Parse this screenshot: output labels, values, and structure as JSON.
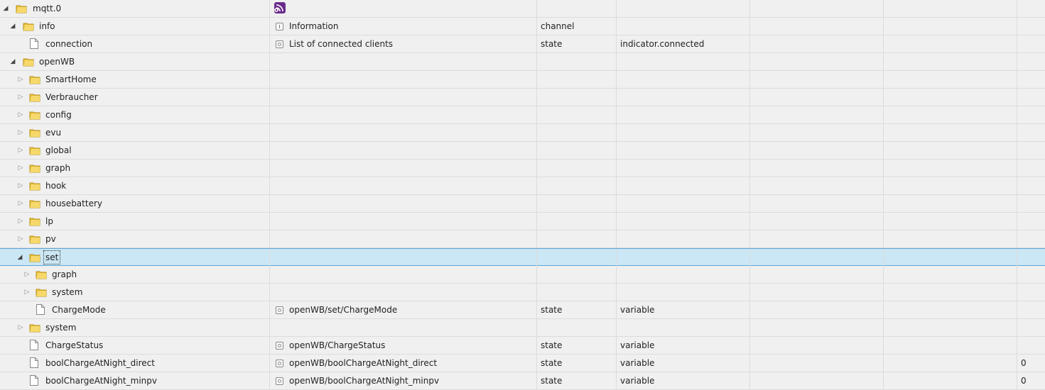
{
  "colors": {
    "background": "#f0f0f0",
    "row_border": "#dcdcdc",
    "selection": "#cbe6f4",
    "selection_border": "#5fa6d6",
    "folder": "#e8c03c"
  },
  "rows": [
    {
      "label": "mqtt.0",
      "name": "",
      "type": "",
      "role": "",
      "extra": "",
      "icon": "adapter-icon"
    },
    {
      "label": "info",
      "name": "Information",
      "type": "channel",
      "role": "",
      "extra": "",
      "icon": "info-icon"
    },
    {
      "label": "connection",
      "name": "List of connected clients",
      "type": "state",
      "role": "indicator.connected",
      "extra": "",
      "icon": "state-icon"
    },
    {
      "label": "openWB",
      "name": "",
      "type": "",
      "role": "",
      "extra": ""
    },
    {
      "label": "SmartHome",
      "name": "",
      "type": "",
      "role": "",
      "extra": ""
    },
    {
      "label": "Verbraucher",
      "name": "",
      "type": "",
      "role": "",
      "extra": ""
    },
    {
      "label": "config",
      "name": "",
      "type": "",
      "role": "",
      "extra": ""
    },
    {
      "label": "evu",
      "name": "",
      "type": "",
      "role": "",
      "extra": ""
    },
    {
      "label": "global",
      "name": "",
      "type": "",
      "role": "",
      "extra": ""
    },
    {
      "label": "graph",
      "name": "",
      "type": "",
      "role": "",
      "extra": ""
    },
    {
      "label": "hook",
      "name": "",
      "type": "",
      "role": "",
      "extra": ""
    },
    {
      "label": "housebattery",
      "name": "",
      "type": "",
      "role": "",
      "extra": ""
    },
    {
      "label": "lp",
      "name": "",
      "type": "",
      "role": "",
      "extra": ""
    },
    {
      "label": "pv",
      "name": "",
      "type": "",
      "role": "",
      "extra": ""
    },
    {
      "label": "set",
      "name": "",
      "type": "",
      "role": "",
      "extra": ""
    },
    {
      "label": "graph",
      "name": "",
      "type": "",
      "role": "",
      "extra": ""
    },
    {
      "label": "system",
      "name": "",
      "type": "",
      "role": "",
      "extra": ""
    },
    {
      "label": "ChargeMode",
      "name": "openWB/set/ChargeMode",
      "type": "state",
      "role": "variable",
      "extra": "",
      "icon": "state-icon"
    },
    {
      "label": "system",
      "name": "",
      "type": "",
      "role": "",
      "extra": ""
    },
    {
      "label": "ChargeStatus",
      "name": "openWB/ChargeStatus",
      "type": "state",
      "role": "variable",
      "extra": "",
      "icon": "state-icon"
    },
    {
      "label": "boolChargeAtNight_direct",
      "name": "openWB/boolChargeAtNight_direct",
      "type": "state",
      "role": "variable",
      "extra": "0",
      "icon": "state-icon"
    },
    {
      "label": "boolChargeAtNight_minpv",
      "name": "openWB/boolChargeAtNight_minpv",
      "type": "state",
      "role": "variable",
      "extra": "0",
      "icon": "state-icon"
    }
  ]
}
